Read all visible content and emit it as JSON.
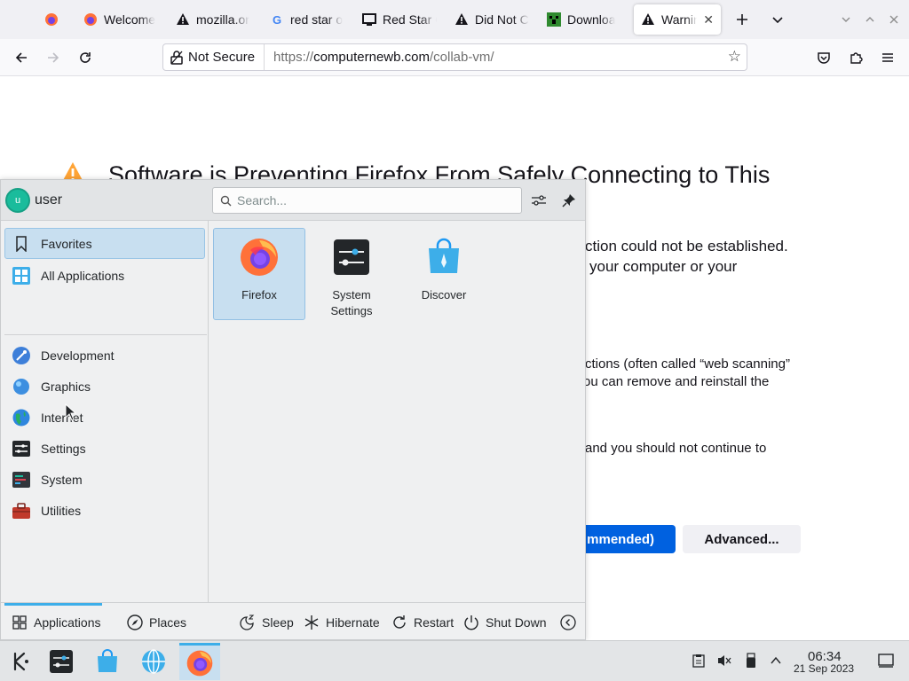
{
  "browser": {
    "tabs": [
      {
        "label": "",
        "icon": "firefox-icon"
      },
      {
        "label": "Welcome",
        "icon": "firefox-icon"
      },
      {
        "label": "mozilla.or",
        "icon": "warning-icon"
      },
      {
        "label": "red star o",
        "icon": "google-icon"
      },
      {
        "label": "Red Star O",
        "icon": "monitor-icon"
      },
      {
        "label": "Did Not C",
        "icon": "warning-icon"
      },
      {
        "label": "Downloa",
        "icon": "minecraft-icon"
      },
      {
        "label": "Warnin",
        "icon": "warning-icon",
        "active": true
      }
    ],
    "url": {
      "security_label": "Not Secure",
      "scheme": "https://",
      "domain": "computernewb.com",
      "path": "/collab-vm/"
    }
  },
  "page": {
    "heading": "Software is Preventing Firefox From Safely Connecting to This",
    "line1": "ction could not be established.",
    "line2": "your computer or your",
    "line3": "ctions (often called “web scanning”",
    "line4": "ou can remove and reinstall the",
    "line5": "and you should not continue to",
    "primary_button": "mmended)",
    "advanced_button": "Advanced..."
  },
  "launcher": {
    "user": {
      "name": "user",
      "initial": "u"
    },
    "search_placeholder": "Search...",
    "categories": [
      {
        "label": "Favorites",
        "icon": "bookmark-icon",
        "selected": true
      },
      {
        "label": "All Applications",
        "icon": "grid-icon"
      },
      {
        "label": "Development",
        "icon": "development-icon"
      },
      {
        "label": "Graphics",
        "icon": "graphics-icon"
      },
      {
        "label": "Internet",
        "icon": "globe-icon"
      },
      {
        "label": "Settings",
        "icon": "settings-icon"
      },
      {
        "label": "System",
        "icon": "system-icon"
      },
      {
        "label": "Utilities",
        "icon": "toolbox-icon"
      }
    ],
    "apps": [
      {
        "label": "Firefox",
        "icon": "firefox-icon",
        "selected": true
      },
      {
        "label": "System Settings",
        "icon": "system-settings-icon"
      },
      {
        "label": "Discover",
        "icon": "discover-icon"
      }
    ],
    "footer": {
      "applications": "Applications",
      "places": "Places",
      "sleep": "Sleep",
      "hibernate": "Hibernate",
      "restart": "Restart",
      "shutdown": "Shut Down"
    }
  },
  "taskbar": {
    "time": "06:34",
    "date": "21 Sep 2023"
  },
  "colors": {
    "accent": "#3daee9",
    "selection": "#c8dff0",
    "firefox_primary_button": "#0061e0"
  }
}
